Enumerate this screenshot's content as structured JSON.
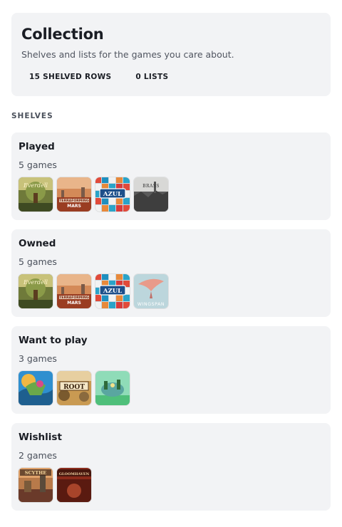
{
  "header": {
    "title": "Collection",
    "subtitle": "Shelves and lists for the games you care about.",
    "stats": [
      "15 SHELVED ROWS",
      "0 LISTS"
    ]
  },
  "section_label": "SHELVES",
  "shelves": [
    {
      "name": "Played",
      "count": "5 games",
      "covers": [
        {
          "icon": "everdell-cover",
          "text": "Everdell"
        },
        {
          "icon": "terraforming-mars-cover",
          "text": "TERRAFORMING MARS"
        },
        {
          "icon": "azul-cover",
          "text": "AZUL"
        },
        {
          "icon": "brass-cover",
          "text": "BRASS"
        }
      ]
    },
    {
      "name": "Owned",
      "count": "5 games",
      "covers": [
        {
          "icon": "everdell-cover",
          "text": "Everdell"
        },
        {
          "icon": "terraforming-mars-cover",
          "text": "TERRAFORMING MARS"
        },
        {
          "icon": "azul-cover",
          "text": "AZUL"
        },
        {
          "icon": "wingspan-cover",
          "text": "WINGSPAN"
        }
      ]
    },
    {
      "name": "Want to play",
      "count": "3 games",
      "covers": [
        {
          "icon": "spirit-island-cover",
          "text": ""
        },
        {
          "icon": "root-cover",
          "text": "ROOT"
        },
        {
          "icon": "cascadia-cover",
          "text": ""
        }
      ]
    },
    {
      "name": "Wishlist",
      "count": "2 games",
      "covers": [
        {
          "icon": "scythe-cover",
          "text": "SCYTHE"
        },
        {
          "icon": "gloomhaven-cover",
          "text": "GLOOMHAVEN"
        }
      ]
    }
  ]
}
